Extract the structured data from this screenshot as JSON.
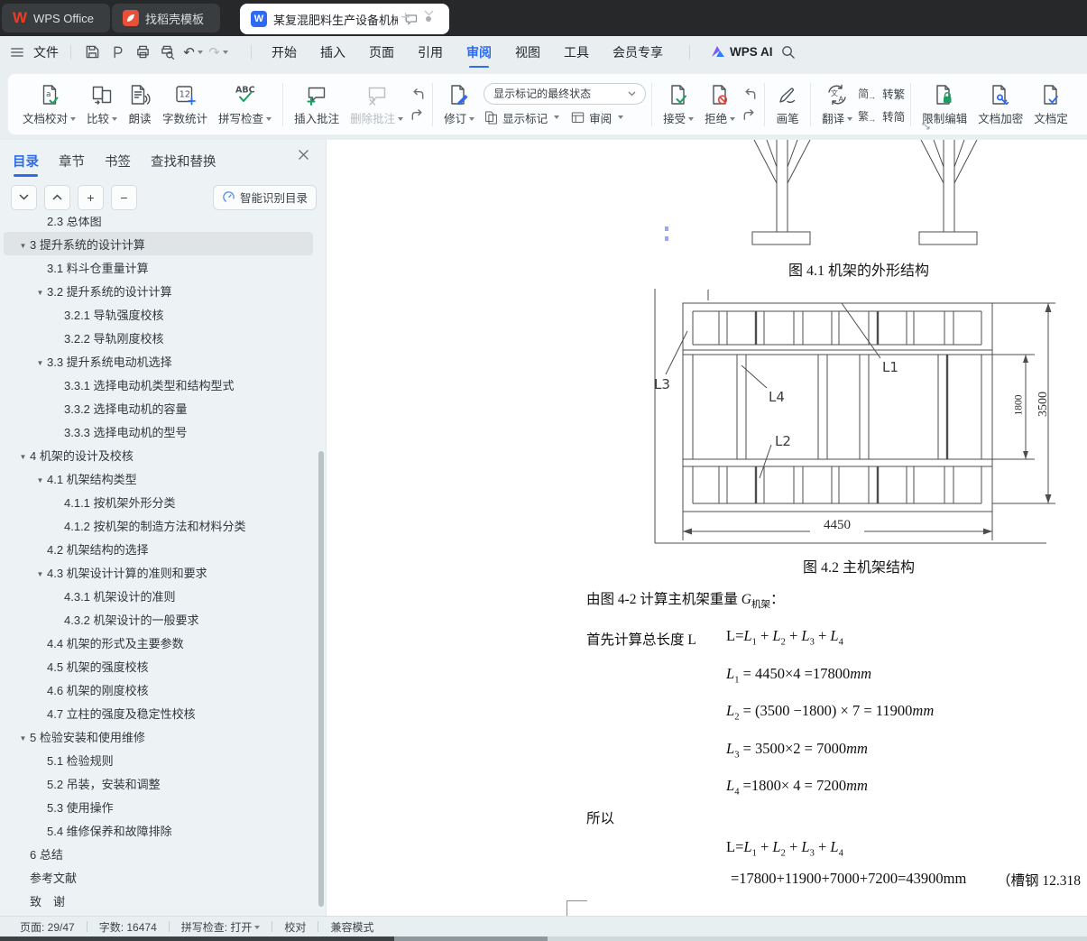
{
  "tabbar": {
    "home_tab": "WPS Office",
    "docer_tab": "找稻壳模板",
    "doc_tab": "某复混肥料生产设备机械结构设"
  },
  "menubar": {
    "file": "文件",
    "items": [
      "开始",
      "插入",
      "页面",
      "引用",
      "审阅",
      "视图",
      "工具",
      "会员专享"
    ],
    "active_item": "审阅",
    "wps_ai": "WPS AI"
  },
  "ribbon": {
    "doc_proof": "文档校对",
    "compare": "比较",
    "read_aloud": "朗读",
    "word_count": "字数统计",
    "spell_check": "拼写检查",
    "insert_comment": "插入批注",
    "delete_comment": "删除批注",
    "track_changes": "修订",
    "markup_state": "显示标记的最终状态",
    "show_markup": "显示标记",
    "review_pane": "审阅",
    "accept": "接受",
    "reject": "拒绝",
    "brush": "画笔",
    "translate": "翻译",
    "to_trad": "转繁",
    "to_simp": "转简",
    "to_trad_icon": "简",
    "to_simp_icon": "繁",
    "restrict_edit": "限制编辑",
    "encrypt": "文档加密",
    "finalize": "文档定"
  },
  "sidebar": {
    "tabs": [
      "目录",
      "章节",
      "书签",
      "查找和替换"
    ],
    "active_tab": "目录",
    "smart_button": "智能识别目录",
    "outline": [
      {
        "text": "2.3 总体图",
        "level": 2,
        "partial": true
      },
      {
        "text": "3 提升系统的设计计算",
        "level": 1,
        "arrow": true,
        "selected": true
      },
      {
        "text": "3.1 料斗仓重量计算",
        "level": 2
      },
      {
        "text": "3.2 提升系统的设计计算",
        "level": 2,
        "arrow": true
      },
      {
        "text": "3.2.1 导轨强度校核",
        "level": 3
      },
      {
        "text": "3.2.2 导轨刚度校核",
        "level": 3
      },
      {
        "text": "3.3 提升系统电动机选择",
        "level": 2,
        "arrow": true
      },
      {
        "text": "3.3.1  选择电动机类型和结构型式",
        "level": 3
      },
      {
        "text": "3.3.2 选择电动机的容量",
        "level": 3
      },
      {
        "text": "3.3.3 选择电动机的型号",
        "level": 3
      },
      {
        "text": "4 机架的设计及校核",
        "level": 1,
        "arrow": true
      },
      {
        "text": "4.1 机架结构类型",
        "level": 2,
        "arrow": true
      },
      {
        "text": "4.1.1 按机架外形分类",
        "level": 3
      },
      {
        "text": "4.1.2 按机架的制造方法和材料分类",
        "level": 3
      },
      {
        "text": "4.2 机架结构的选择",
        "level": 2
      },
      {
        "text": "4.3 机架设计计算的准则和要求",
        "level": 2,
        "arrow": true
      },
      {
        "text": "4.3.1 机架设计的准则",
        "level": 3
      },
      {
        "text": "4.3.2 机架设计的一般要求",
        "level": 3
      },
      {
        "text": "4.4 机架的形式及主要参数",
        "level": 2
      },
      {
        "text": "4.5 机架的强度校核",
        "level": 2
      },
      {
        "text": "4.6 机架的刚度校核",
        "level": 2
      },
      {
        "text": "4.7 立柱的强度及稳定性校核",
        "level": 2
      },
      {
        "text": "5 检验安装和使用维修",
        "level": 1,
        "arrow": true
      },
      {
        "text": "5.1 检验规则",
        "level": 2
      },
      {
        "text": "5.2 吊装，安装和调整",
        "level": 2
      },
      {
        "text": "5.3 使用操作",
        "level": 2
      },
      {
        "text": "5.4 维修保养和故障排除",
        "level": 2
      },
      {
        "text": "6 总结",
        "level": 1
      },
      {
        "text": "参考文献",
        "level": 1
      },
      {
        "text": "致　谢",
        "level": 1
      }
    ]
  },
  "document": {
    "fig41_caption": "图 4.1 机架的外形结构",
    "fig42_caption": "图 4.2 主机架结构",
    "fig42_labels": {
      "l1": "L1",
      "l2": "L2",
      "l3": "L3",
      "l4": "L4"
    },
    "fig42_dims": {
      "width": "4450",
      "inner_height": "1800",
      "outer_height": "3500"
    },
    "para_calc_weight": [
      {
        "r": "由图 4-2 计算主机架重量 "
      },
      {
        "v": "G",
        "s": "机架"
      },
      {
        "r": "："
      }
    ],
    "para_total_length": "首先计算总长度 L",
    "suoyi": "所以",
    "note": "（槽钢 12.318",
    "math": {
      "sum": [
        {
          "r": "L="
        },
        {
          "v": "L",
          "s": "1"
        },
        {
          "r": " + "
        },
        {
          "v": "L",
          "s": "2"
        },
        {
          "r": " + "
        },
        {
          "v": "L",
          "s": "3"
        },
        {
          "r": " + "
        },
        {
          "v": "L",
          "s": "4"
        }
      ],
      "f1": [
        {
          "v": "L",
          "s": "1"
        },
        {
          "r": " = 4450×4 =17800"
        },
        {
          "i": "mm"
        }
      ],
      "f2": [
        {
          "v": "L",
          "s": "2"
        },
        {
          "r": " = (3500 −1800) × 7 = 11900"
        },
        {
          "i": "mm"
        }
      ],
      "f3": [
        {
          "v": "L",
          "s": "3"
        },
        {
          "r": " = 3500×2 = 7000"
        },
        {
          "i": "mm"
        }
      ],
      "f4": [
        {
          "v": "L",
          "s": "4"
        },
        {
          "r": " =1800× 4 = 7200"
        },
        {
          "i": "mm"
        }
      ],
      "sum2": [
        {
          "r": "L="
        },
        {
          "v": "L",
          "s": "1"
        },
        {
          "r": " + "
        },
        {
          "v": "L",
          "s": "2"
        },
        {
          "r": " + "
        },
        {
          "v": "L",
          "s": "3"
        },
        {
          "r": " + "
        },
        {
          "v": "L",
          "s": "4"
        }
      ],
      "result": [
        {
          "r": "=17800+11900+7000+7200=43900mm"
        }
      ]
    }
  },
  "statusbar": {
    "page": "页面: 29/47",
    "words": "字数: 16474",
    "spell": "拼写检查: 打开",
    "proof": "校对",
    "mode": "兼容模式"
  }
}
